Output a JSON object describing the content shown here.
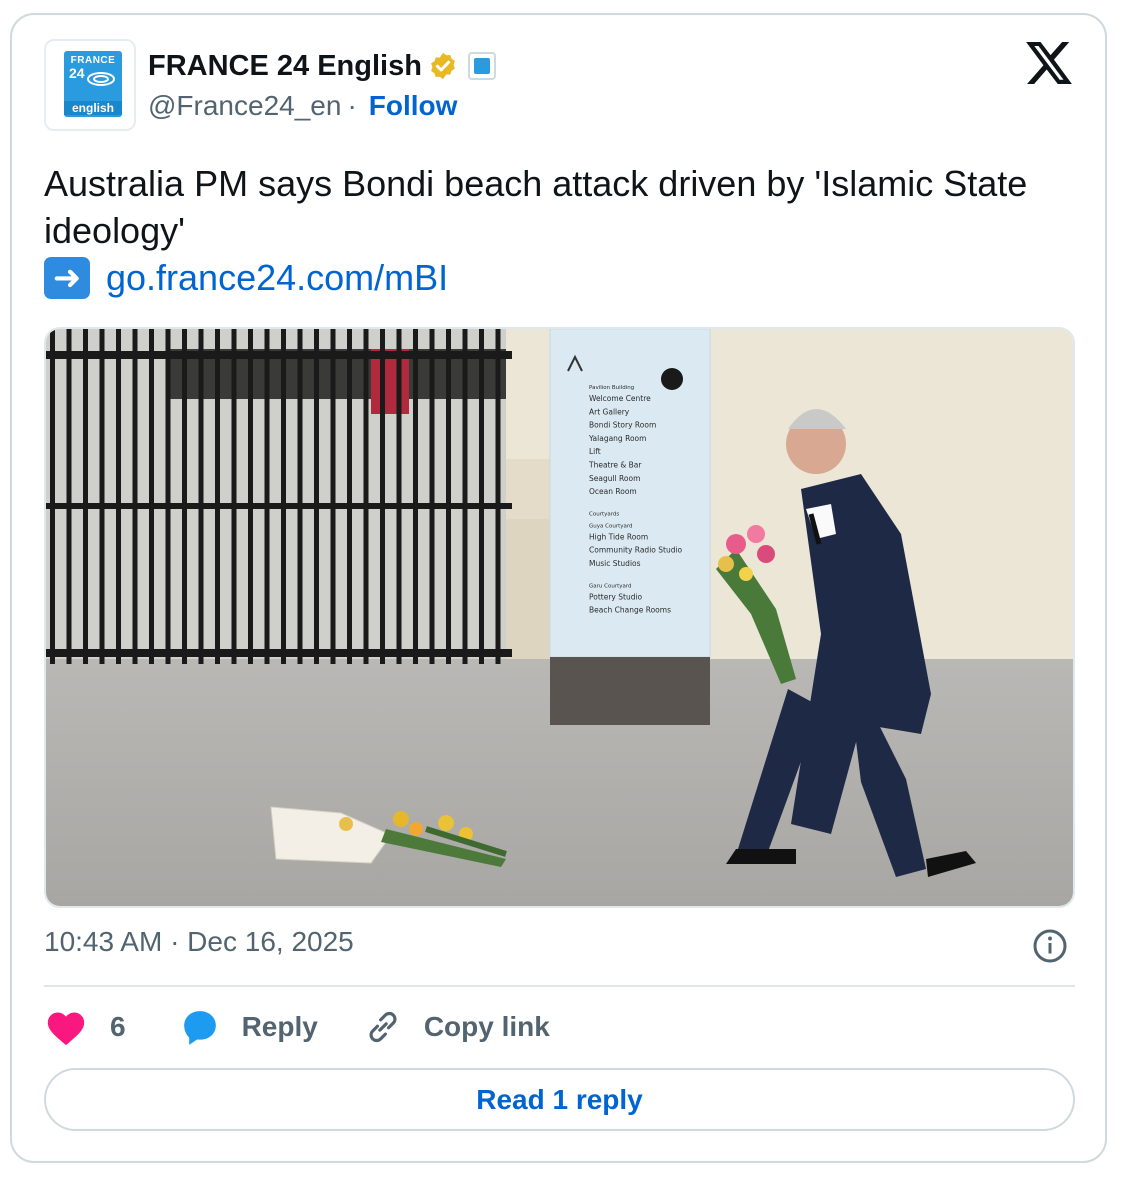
{
  "account": {
    "avatar_top": "FRANCE",
    "avatar_num": "24",
    "avatar_bottom": "english",
    "display_name": "FRANCE 24 English",
    "handle": "@France24_en",
    "separator": "·",
    "follow_label": "Follow"
  },
  "tweet": {
    "text": "Australia PM says Bondi beach attack driven by 'Islamic State ideology'",
    "link_arrow": "➜",
    "link_text": "go.france24.com/mBI"
  },
  "media": {
    "sign_lines": [
      "Pavilion Building",
      "Welcome Centre",
      "Art Gallery",
      "Bondi Story Room",
      "Yalagang Room",
      "Lift",
      "Theatre & Bar",
      "Seagull Room",
      "Ocean Room",
      "Courtyards",
      "Guya Courtyard",
      "High Tide Room",
      "Community Radio Studio",
      "Music Studios",
      "Garu Courtyard",
      "Pottery Studio",
      "Beach Change Rooms"
    ]
  },
  "meta": {
    "timestamp": "10:43 AM · Dec 16, 2025"
  },
  "actions": {
    "like_count": "6",
    "reply_label": "Reply",
    "copy_label": "Copy link"
  },
  "read_reply_label": "Read 1 reply",
  "colors": {
    "link_blue": "#0064d1",
    "like_pink": "#f91880",
    "reply_blue": "#1d9bf0",
    "muted": "#536471",
    "border": "#cfd9de"
  }
}
